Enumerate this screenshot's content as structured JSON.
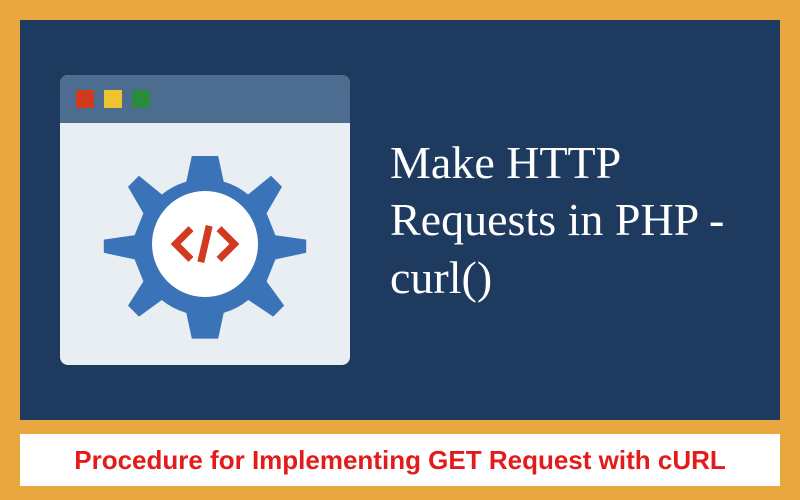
{
  "colors": {
    "frame_bg": "#e8a83f",
    "panel_bg": "#1e3a5f",
    "window_bg": "#e8eef2",
    "titlebar_bg": "#4d6d90",
    "gear": "#3b73b8",
    "code_bracket": "#d13a1e",
    "caption_bg": "#ffffff",
    "caption_text": "#e31b1b"
  },
  "window_dots": [
    "red",
    "yellow",
    "green"
  ],
  "headline": "Make HTTP Requests in PHP - curl()",
  "caption": "Procedure for Implementing GET Request with cURL",
  "icons": {
    "gear": "gear-icon",
    "code_brackets": "code-brackets-icon"
  }
}
